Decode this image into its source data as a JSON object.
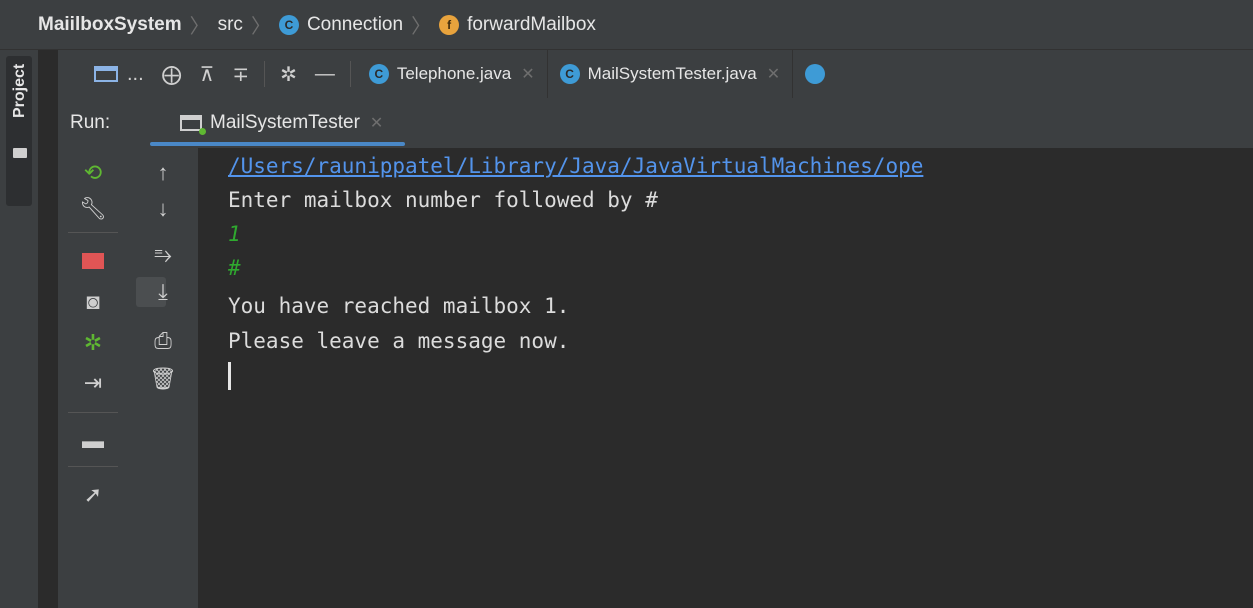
{
  "breadcrumb": {
    "root": "MaiilboxSystem",
    "items": [
      "src",
      "Connection",
      "forwardMailbox"
    ],
    "item_badges": [
      "",
      "C",
      "f"
    ]
  },
  "sidebar": {
    "project_label": "Project"
  },
  "editor_tabs": [
    {
      "label": "Telephone.java",
      "badge": "C"
    },
    {
      "label": "MailSystemTester.java",
      "badge": "C"
    }
  ],
  "toolbar": {
    "ellipsis": "..."
  },
  "run": {
    "label": "Run:",
    "tab_label": "MailSystemTester"
  },
  "console": {
    "lines": [
      {
        "text": "/Users/raunippatel/Library/Java/JavaVirtualMachines/ope",
        "kind": "link"
      },
      {
        "text": "Enter mailbox number followed by #",
        "kind": "out"
      },
      {
        "text": "1",
        "kind": "in"
      },
      {
        "text": "#",
        "kind": "in"
      },
      {
        "text": "You have reached mailbox 1.",
        "kind": "out"
      },
      {
        "text": "Please leave a message now.",
        "kind": "out"
      }
    ]
  },
  "icons": {
    "rerun": "rerun-icon",
    "wrench": "wrench-icon",
    "stop": "stop-icon",
    "camera": "camera-icon",
    "debug": "debug-icon",
    "import": "import-icon",
    "layout": "layout-icon",
    "pin": "pin-icon",
    "up": "arrow-up-icon",
    "down": "arrow-down-icon",
    "wrap": "soft-wrap-icon",
    "scroll": "scroll-to-end-icon",
    "print": "print-icon",
    "trash": "trash-icon"
  },
  "colors": {
    "link": "#5394ec",
    "input": "#2fa92f",
    "accent": "#4a88c7",
    "class_badge": "#3e9bd6",
    "field_badge": "#e8a33d"
  }
}
